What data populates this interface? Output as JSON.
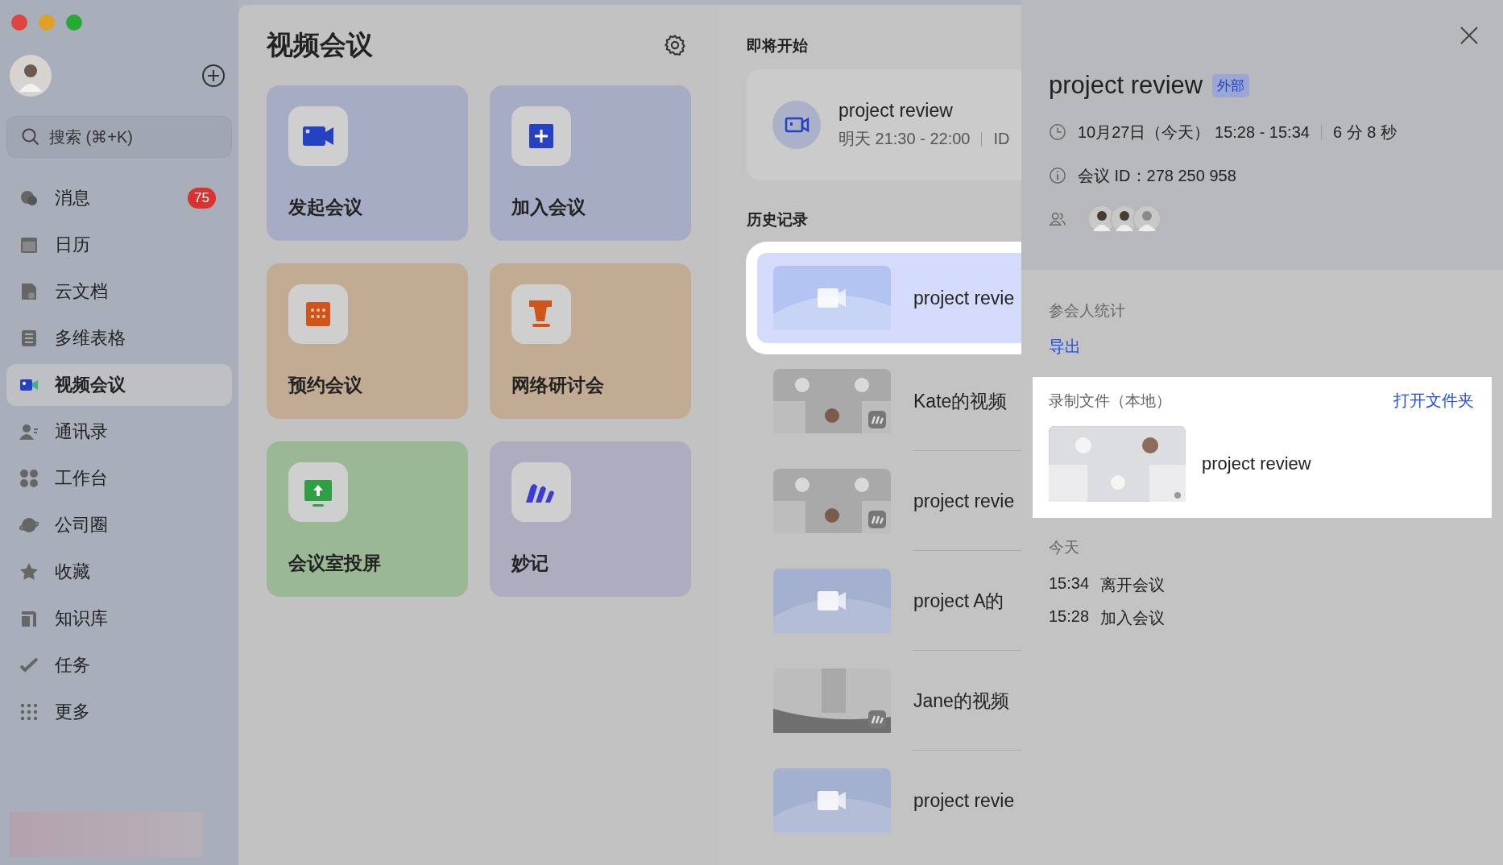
{
  "sidebar": {
    "search": {
      "placeholder": "搜索 (⌘+K)"
    },
    "items": [
      {
        "label": "消息",
        "selected": false,
        "badge": "75"
      },
      {
        "label": "日历",
        "selected": false
      },
      {
        "label": "云文档",
        "selected": false
      },
      {
        "label": "多维表格",
        "selected": false
      },
      {
        "label": "视频会议",
        "selected": true
      },
      {
        "label": "通讯录",
        "selected": false
      },
      {
        "label": "工作台",
        "selected": false
      },
      {
        "label": "公司圈",
        "selected": false
      },
      {
        "label": "收藏",
        "selected": false
      },
      {
        "label": "知识库",
        "selected": false
      },
      {
        "label": "任务",
        "selected": false
      },
      {
        "label": "更多",
        "selected": false
      }
    ]
  },
  "main": {
    "title": "视频会议",
    "actions": [
      {
        "label": "发起会议",
        "color": "#a6acc3"
      },
      {
        "label": "加入会议",
        "color": "#a6acc3"
      },
      {
        "label": "预约会议",
        "color": "#c1ab93"
      },
      {
        "label": "网络研讨会",
        "color": "#c1ab93"
      },
      {
        "label": "会议室投屏",
        "color": "#9ab893"
      },
      {
        "label": "妙记",
        "color": "#aeadbf"
      }
    ]
  },
  "upcoming": {
    "heading": "即将开始",
    "meeting": {
      "title": "project review",
      "time": "明天 21:30 - 22:00",
      "id_label": "ID"
    }
  },
  "history": {
    "heading": "历史记录",
    "rows": [
      {
        "title": "project revie",
        "kind": "camera",
        "selected": true
      },
      {
        "title": "Kate的视频",
        "kind": "grid",
        "selected": false
      },
      {
        "title": "project revie",
        "kind": "grid",
        "selected": false
      },
      {
        "title": "project A的",
        "kind": "camera",
        "selected": false
      },
      {
        "title": "Jane的视频",
        "kind": "blurred",
        "selected": false
      },
      {
        "title": "project revie",
        "kind": "camera",
        "selected": false
      }
    ]
  },
  "detail": {
    "title": "project review",
    "tag": "外部",
    "date": "10月27日（今天） 15:28 - 15:34",
    "duration": "6 分 8 秒",
    "meeting_id": "会议 ID：278 250 958",
    "attendee_stats": "参会人统计",
    "export": "导出",
    "recordings": {
      "heading": "录制文件（本地）",
      "open_folder": "打开文件夹",
      "file": "project review"
    },
    "log": {
      "heading": "今天",
      "entries": [
        {
          "time": "15:34",
          "event": "离开会议"
        },
        {
          "time": "15:28",
          "event": "加入会议"
        }
      ]
    }
  }
}
